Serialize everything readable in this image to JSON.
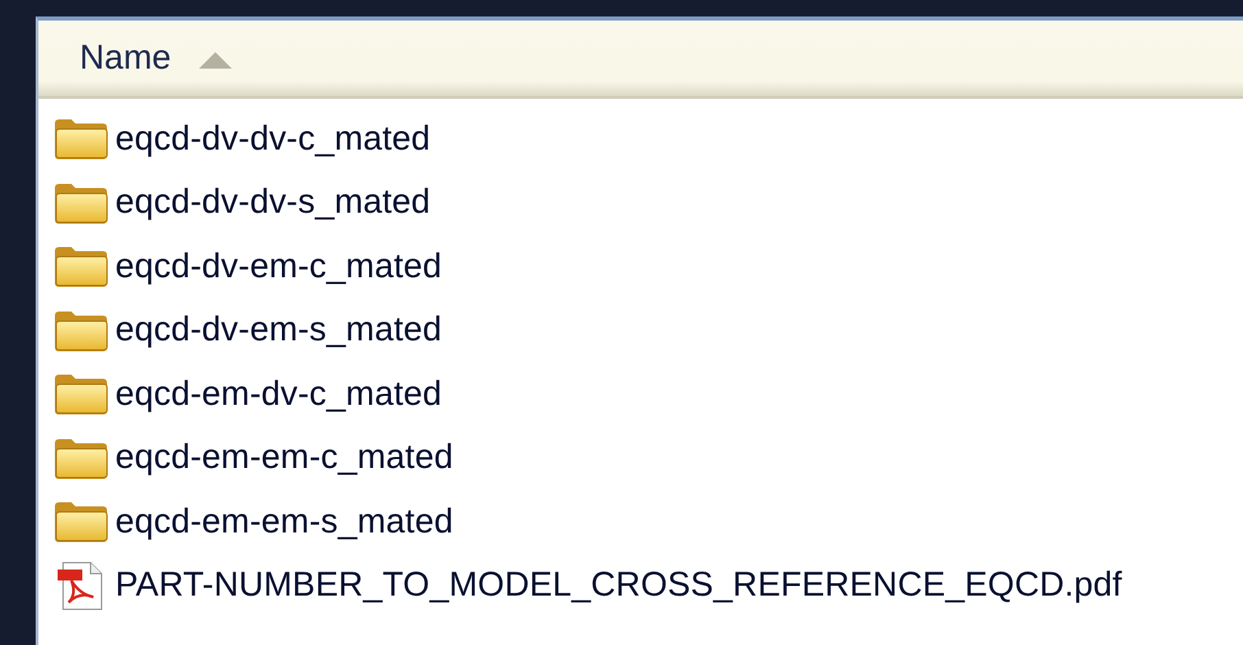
{
  "header": {
    "column": "Name",
    "sort_ascending": true
  },
  "files": [
    {
      "name": "eqcd-dv-dv-c_mated",
      "kind": "folder"
    },
    {
      "name": "eqcd-dv-dv-s_mated",
      "kind": "folder"
    },
    {
      "name": "eqcd-dv-em-c_mated",
      "kind": "folder"
    },
    {
      "name": "eqcd-dv-em-s_mated",
      "kind": "folder"
    },
    {
      "name": "eqcd-em-dv-c_mated",
      "kind": "folder"
    },
    {
      "name": "eqcd-em-em-c_mated",
      "kind": "folder"
    },
    {
      "name": "eqcd-em-em-s_mated",
      "kind": "folder"
    },
    {
      "name": "PART-NUMBER_TO_MODEL_CROSS_REFERENCE_EQCD.pdf",
      "kind": "pdf"
    }
  ]
}
